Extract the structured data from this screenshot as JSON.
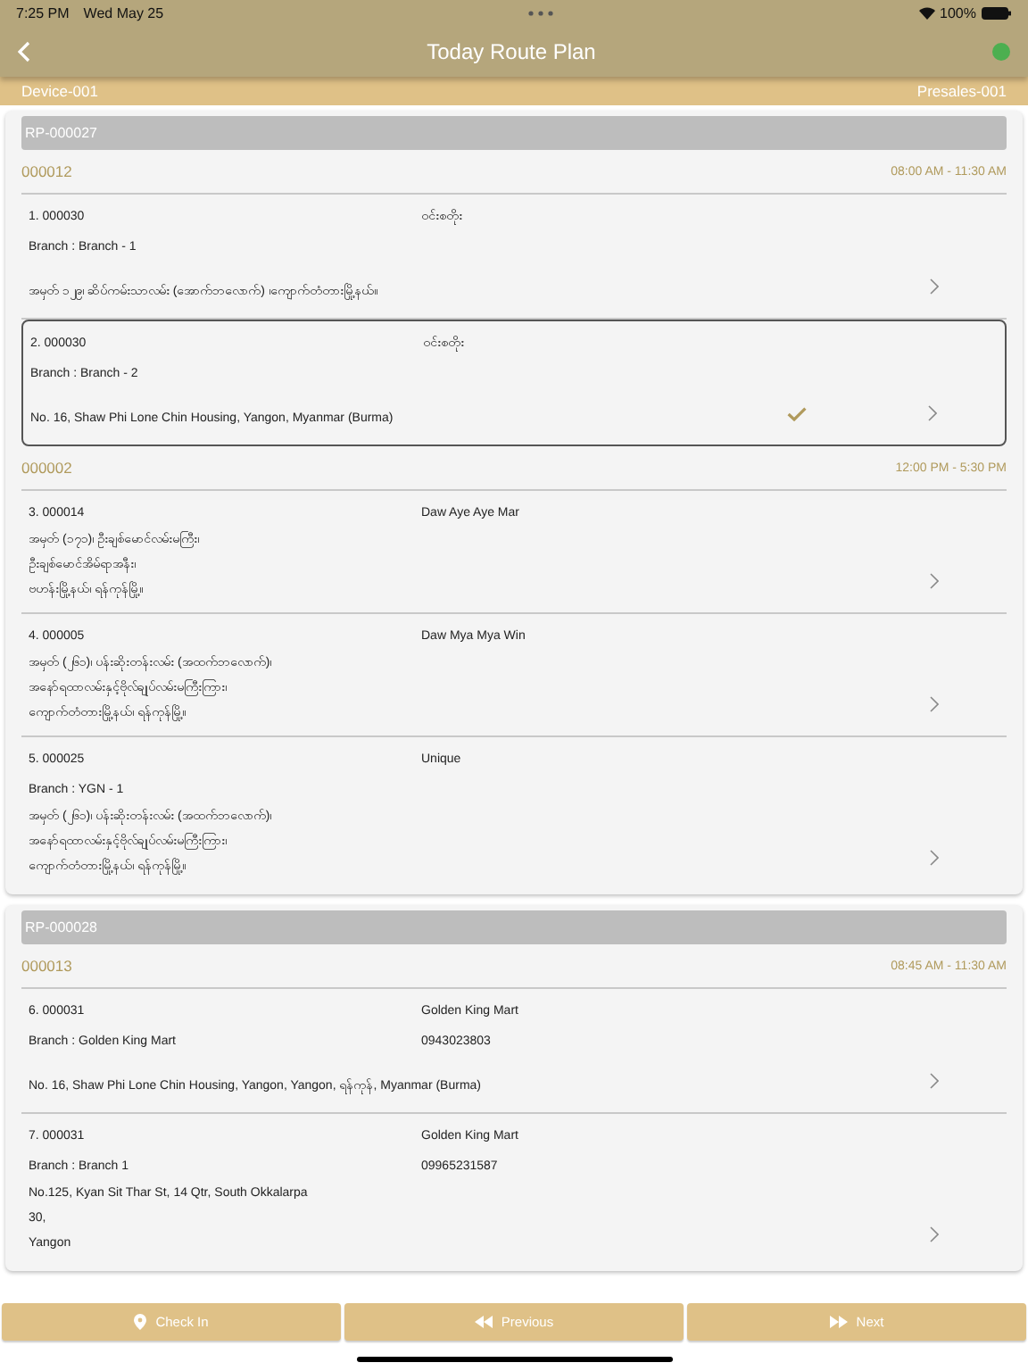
{
  "status_bar": {
    "time": "7:25 PM",
    "date": "Wed May 25",
    "battery": "100%"
  },
  "nav": {
    "title": "Today Route Plan",
    "online": true
  },
  "subheader": {
    "device": "Device-001",
    "presales": "Presales-001"
  },
  "plans": [
    {
      "code": "RP-000027",
      "groups": [
        {
          "customer": "000012",
          "time": "08:00 AM - 11:30 AM",
          "stops": [
            {
              "title": "1. 000030",
              "name": "ဝင်းစတိုး",
              "branch": "Branch : Branch - 1",
              "address": [
                "အမှတ် ၁၂၉၊ ဆိပ်ကမ်းသာလမ်း (အောက်ဘလောက်) ၊ကျောက်တံတားမြို့နယ်။"
              ],
              "checked": false,
              "selected": false
            },
            {
              "title": "2. 000030",
              "name": "ဝင်းစတိုး",
              "branch": "Branch : Branch - 2",
              "address": [
                "No. 16, Shaw Phi Lone Chin Housing, Yangon, Myanmar (Burma)"
              ],
              "checked": true,
              "selected": true
            }
          ]
        },
        {
          "customer": "000002",
          "time": "12:00 PM - 5:30 PM",
          "stops": [
            {
              "title": "3. 000014",
              "name": "Daw Aye Aye Mar",
              "address": [
                "အမှတ် (၁၇၁)၊ ဦးချစ်မောင်လမ်းမကြီး၊",
                "ဦးချစ်မောင်အိမ်ရာအနီး၊",
                "ဗဟန်းမြို့နယ်၊ ရန်ကုန်မြို့။"
              ],
              "checked": false,
              "selected": false
            },
            {
              "title": "4. 000005",
              "name": "Daw Mya Mya Win",
              "address": [
                "အမှတ် (၂၆၁)၊ ပန်းဆိုးတန်းလမ်း (အထက်ဘလောက်)၊",
                "အနော်ရထာလမ်းနှင့်ဗိုလ်ချုပ်လမ်းမကြီးကြား၊",
                "ကျောက်တံတားမြို့နယ်၊ ရန်ကုန်မြို့။"
              ],
              "checked": false,
              "selected": false
            },
            {
              "title": "5. 000025",
              "name": "Unique",
              "branch": "Branch : YGN - 1",
              "address": [
                "အမှတ် (၂၆၁)၊ ပန်းဆိုးတန်းလမ်း (အထက်ဘလောက်)၊",
                "အနော်ရထာလမ်းနှင့်ဗိုလ်ချုပ်လမ်းမကြီးကြား၊",
                "ကျောက်တံတားမြို့နယ်၊ ရန်ကုန်မြို့။"
              ],
              "checked": false,
              "selected": false
            }
          ]
        }
      ]
    },
    {
      "code": "RP-000028",
      "groups": [
        {
          "customer": "000013",
          "time": "08:45 AM - 11:30 AM",
          "stops": [
            {
              "title": "6. 000031",
              "name": "Golden King Mart",
              "branch": "Branch : Golden King Mart",
              "phone": "0943023803",
              "address": [
                "No. 16, Shaw Phi Lone Chin Housing, Yangon, Yangon, ရန်ကုန်, Myanmar (Burma)"
              ],
              "checked": false,
              "selected": false
            },
            {
              "title": "7. 000031",
              "name": "Golden King Mart",
              "branch": "Branch : Branch 1",
              "phone": "09965231587",
              "address": [
                "No.125, Kyan Sit Thar St, 14 Qtr, South Okkalarpa",
                "30,",
                "Yangon"
              ],
              "checked": false,
              "selected": false
            }
          ]
        }
      ]
    }
  ],
  "buttons": [
    {
      "kind": "checkin",
      "label": "Check In"
    },
    {
      "kind": "previous",
      "label": "Previous"
    },
    {
      "kind": "next",
      "label": "Next"
    }
  ]
}
